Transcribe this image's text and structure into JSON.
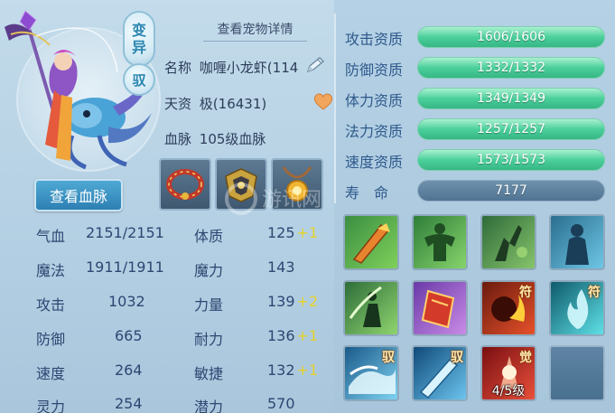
{
  "header": {
    "view_detail_link": "查看宠物详情",
    "badge_variant_line1": "变",
    "badge_variant_line2": "异",
    "badge_tame": "驭"
  },
  "pet": {
    "name_label": "名称",
    "name_value": "咖喱小龙虾(114",
    "aptitude_label": "天资",
    "aptitude_value": "极(16431)",
    "bloodline_label": "血脉",
    "bloodline_value": "105级血脉"
  },
  "bloodline_button": "查看血脉",
  "watermark_text": "游讯网",
  "stats_left": [
    {
      "label": "气血",
      "value": "2151/2151"
    },
    {
      "label": "魔法",
      "value": "1911/1911"
    },
    {
      "label": "攻击",
      "value": "1032"
    },
    {
      "label": "防御",
      "value": "665"
    },
    {
      "label": "速度",
      "value": "264"
    },
    {
      "label": "灵力",
      "value": "254"
    }
  ],
  "stats_right": [
    {
      "label": "体质",
      "value": "125",
      "bonus": "+1"
    },
    {
      "label": "魔力",
      "value": "143",
      "bonus": ""
    },
    {
      "label": "力量",
      "value": "139",
      "bonus": "+2"
    },
    {
      "label": "耐力",
      "value": "136",
      "bonus": "+1"
    },
    {
      "label": "敏捷",
      "value": "132",
      "bonus": "+1"
    },
    {
      "label": "潜力",
      "value": "570",
      "bonus": ""
    }
  ],
  "aptitudes": [
    {
      "label": "攻击资质",
      "value": "1606/1606",
      "fill": 1.0
    },
    {
      "label": "防御资质",
      "value": "1332/1332",
      "fill": 1.0
    },
    {
      "label": "体力资质",
      "value": "1349/1349",
      "fill": 1.0
    },
    {
      "label": "法力资质",
      "value": "1257/1257",
      "fill": 1.0
    },
    {
      "label": "速度资质",
      "value": "1573/1573",
      "fill": 1.0
    }
  ],
  "lifespan": {
    "label": "寿　命",
    "value": "7177"
  },
  "skills": [
    {
      "tag": "",
      "level": "",
      "icon": "blade-strike-icon"
    },
    {
      "tag": "",
      "level": "",
      "icon": "muscle-man-icon"
    },
    {
      "tag": "",
      "level": "",
      "icon": "poison-shadow-icon"
    },
    {
      "tag": "",
      "level": "",
      "icon": "ghost-figure-icon"
    },
    {
      "tag": "",
      "level": "",
      "icon": "leaf-warrior-icon"
    },
    {
      "tag": "",
      "level": "",
      "icon": "red-shield-icon"
    },
    {
      "tag": "符",
      "level": "",
      "icon": "fire-demon-icon"
    },
    {
      "tag": "符",
      "level": "",
      "icon": "blue-flame-icon"
    },
    {
      "tag": "驭",
      "level": "",
      "icon": "water-wave-icon"
    },
    {
      "tag": "驭",
      "level": "",
      "icon": "ice-sword-icon"
    },
    {
      "tag": "觉",
      "level": "4/5级",
      "icon": "awaken-burst-icon"
    },
    {
      "tag": "",
      "level": "",
      "icon": "empty-slot"
    }
  ],
  "equipment": [
    "red-collar-icon",
    "gold-armor-icon",
    "sun-amulet-icon"
  ],
  "colors": {
    "aptitude_bar": "#4bcf9b",
    "bonus_text": "#e6d22a",
    "button_blue": "#2d7fb3"
  }
}
